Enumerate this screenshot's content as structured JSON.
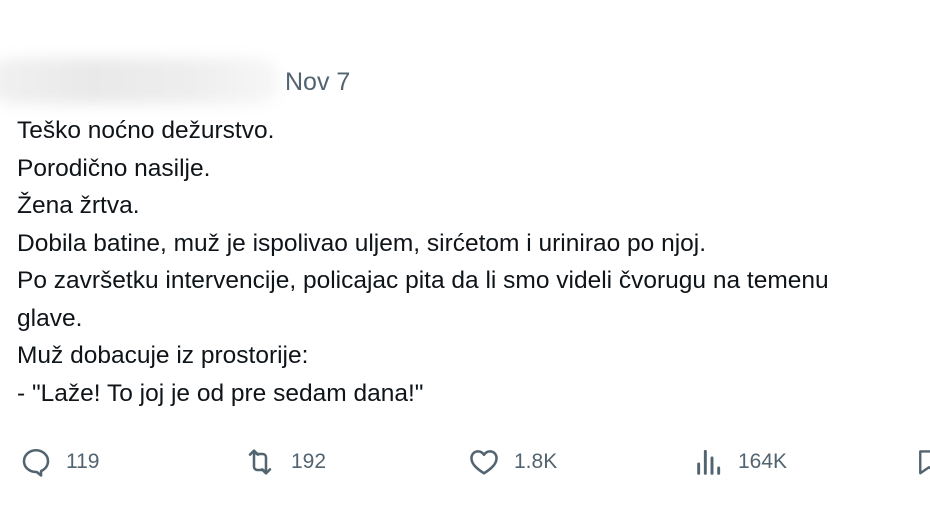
{
  "tweet": {
    "date": "Nov 7",
    "lines": [
      "Teško noćno dežurstvo.",
      "Porodično nasilje.",
      "Žena žrtva.",
      "Dobila batine, muž je ispolivao uljem, sirćetom i urinirao po njoj.",
      "Po završetku intervencije, policajac pita da li smo videli čvorugu na temenu",
      "glave.",
      "Muž dobacuje iz prostorije:",
      "- \"Laže! To joj je od pre sedam dana!\""
    ]
  },
  "actions": {
    "reply": {
      "icon": "reply-icon",
      "count": "119"
    },
    "repost": {
      "icon": "repost-icon",
      "count": "192"
    },
    "like": {
      "icon": "heart-icon",
      "count": "1.8K"
    },
    "views": {
      "icon": "views-icon",
      "count": "164K"
    },
    "bookmark": {
      "icon": "bookmark-icon"
    }
  },
  "colors": {
    "text": "#0f1419",
    "secondary": "#536471",
    "background": "#ffffff"
  }
}
